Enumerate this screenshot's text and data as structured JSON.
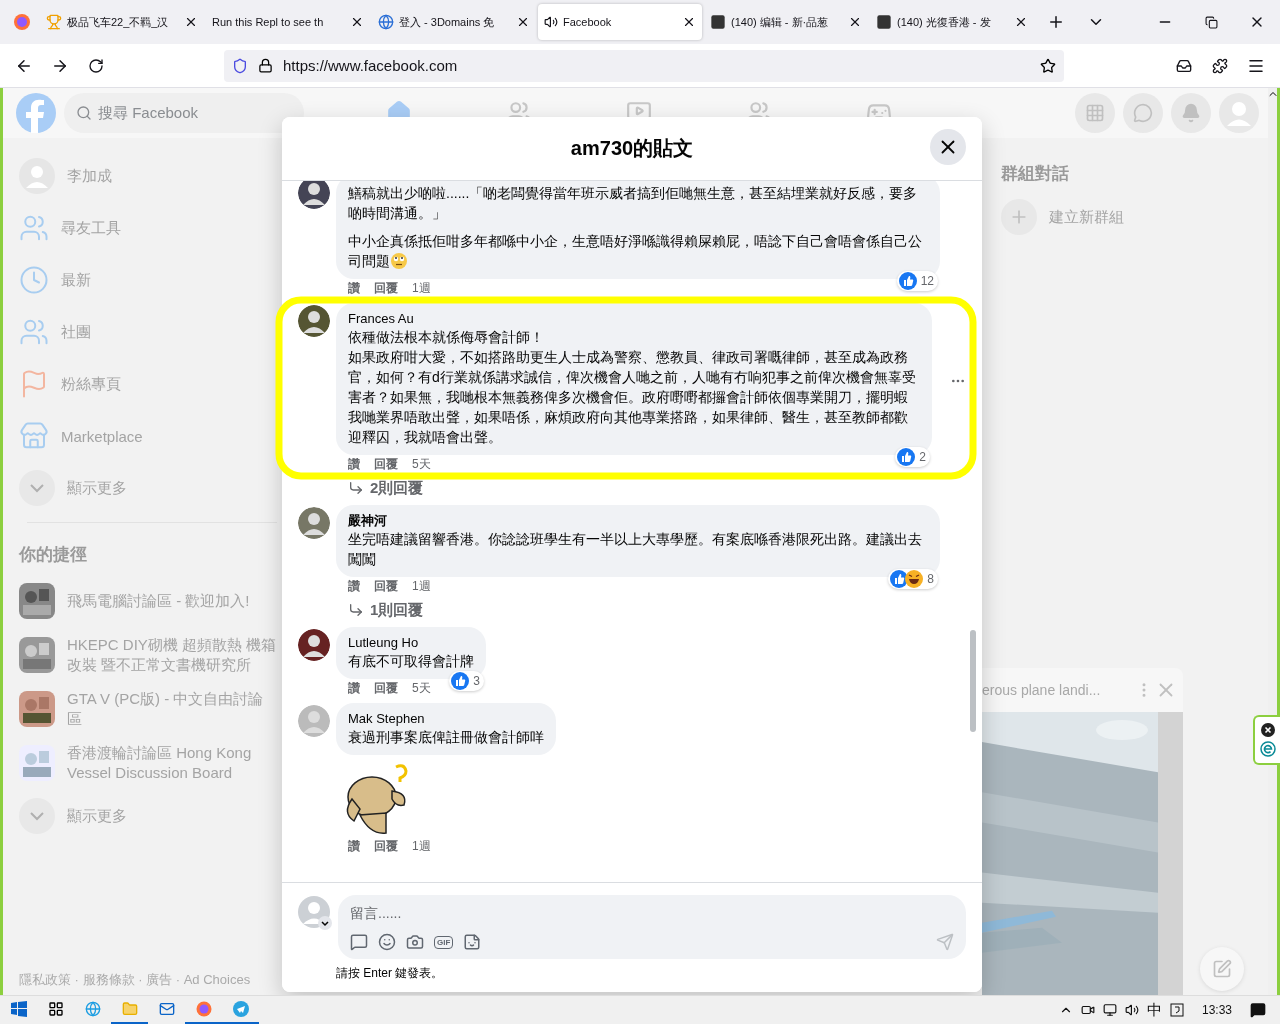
{
  "browser": {
    "tabs": [
      {
        "title": "极品飞车22_不羁_汉",
        "selected": false
      },
      {
        "title": "Run this Repl to see th",
        "selected": false
      },
      {
        "title": "登入 - 3Domains 免",
        "selected": false
      },
      {
        "title": "Facebook",
        "selected": true
      },
      {
        "title": "(140) 编辑 - 新·品葱",
        "selected": false
      },
      {
        "title": "(140) 光復香港 - 发",
        "selected": false
      }
    ],
    "url": "https://www.facebook.com"
  },
  "facebook": {
    "search_placeholder": "搜尋 Facebook",
    "sidebar": {
      "items": [
        {
          "label": "李加成"
        },
        {
          "label": "尋友工具"
        },
        {
          "label": "最新"
        },
        {
          "label": "社團"
        },
        {
          "label": "粉絲專頁"
        },
        {
          "label": "Marketplace"
        },
        {
          "label": "顯示更多"
        }
      ],
      "shortcuts_heading": "你的捷徑",
      "shortcuts": [
        {
          "label": "飛馬電腦討論區 - 歡迎加入!"
        },
        {
          "label": "HKEPC DIY砌機 超頻散熱 機箱改裝 暨不正常文書機研究所"
        },
        {
          "label": "GTA V (PC版) - 中文自由討論區"
        },
        {
          "label": "香港渡輪討論區 Hong Kong Vessel Discussion Board"
        }
      ],
      "shortcuts_more": "顯示更多",
      "footer": "隱私政策 · 服務條款 · 廣告 · Ad Choices"
    },
    "contacts": {
      "heading": "群組對話",
      "create_group": "建立新群組"
    },
    "video_popup": {
      "title": "erous plane landi..."
    }
  },
  "modal": {
    "title": "am730的貼文",
    "comments": [
      {
        "paragraphs": [
          [
            "鱔稿就出少啲啦......「啲老闆覺得當年班示威者搞到佢哋無生意，甚至結埋業就好反感，要多啲時間溝通。」"
          ],
          [
            "中小企真係抵佢咁多年都喺中小企，生意唔好淨喺識得賴屎賴屁，唔諗下自己會唔會係自己公司問題"
          ]
        ],
        "emoji": true,
        "like": "讚",
        "reply": "回覆",
        "time": "1週",
        "reactions": [
          {
            "kind": "like"
          }
        ],
        "reaction_count": "12",
        "options": false
      },
      {
        "author": "Frances Au",
        "paragraphs": [
          [
            "依種做法根本就係侮辱會計師！",
            "如果政府咁大愛，不如搭路助更生人士成為警察、懲教員、律政司署嘅律師，甚至成為政務官，如何？有d行業就係講求誠信，俾次機會人哋之前，人哋有冇响犯事之前俾次機會無辜受害者？如果無，我哋根本無義務俾多次機會佢。政府嘢嘢都攞會計師依個專業開刀，擺明蝦我哋業界唔敢出聲，如果唔係，麻煩政府向其他專業搭路，如果律師、醫生，甚至教師都歡迎釋囚，我就唔會出聲。"
          ]
        ],
        "like": "讚",
        "reply": "回覆",
        "time": "5天",
        "reactions": [
          {
            "kind": "like"
          }
        ],
        "reaction_count": "2",
        "replies": "2則回覆",
        "options": true
      },
      {
        "author": "嚴神河",
        "paragraphs": [
          [
            "坐完唔建議留響香港。你諗諗班學生有一半以上大專學歷。有案底喺香港限死出路。建議出去闖闖"
          ]
        ],
        "like": "讚",
        "reply": "回覆",
        "time": "1週",
        "reactions": [
          {
            "kind": "like"
          },
          {
            "kind": "haha"
          }
        ],
        "reaction_count": "8",
        "replies": "1則回覆",
        "options": false
      },
      {
        "author": "Lutleung Ho",
        "paragraphs": [
          [
            "有底不可取得會計牌"
          ]
        ],
        "like": "讚",
        "reply": "回覆",
        "time": "5天",
        "reactions": [
          {
            "kind": "like"
          }
        ],
        "reaction_count": "3",
        "options": false
      },
      {
        "author": "Mak Stephen",
        "paragraphs": [
          [
            "衰過刑事案底俾註冊做會計師咩"
          ]
        ],
        "sticker": true,
        "like": "讚",
        "reply": "回覆",
        "time": "1週",
        "options": false
      }
    ],
    "composer": {
      "placeholder": "留言......",
      "gif": "GIF",
      "hint": "請按 Enter 鍵發表。"
    }
  },
  "taskbar": {
    "ime": "中",
    "time": "13:33"
  }
}
